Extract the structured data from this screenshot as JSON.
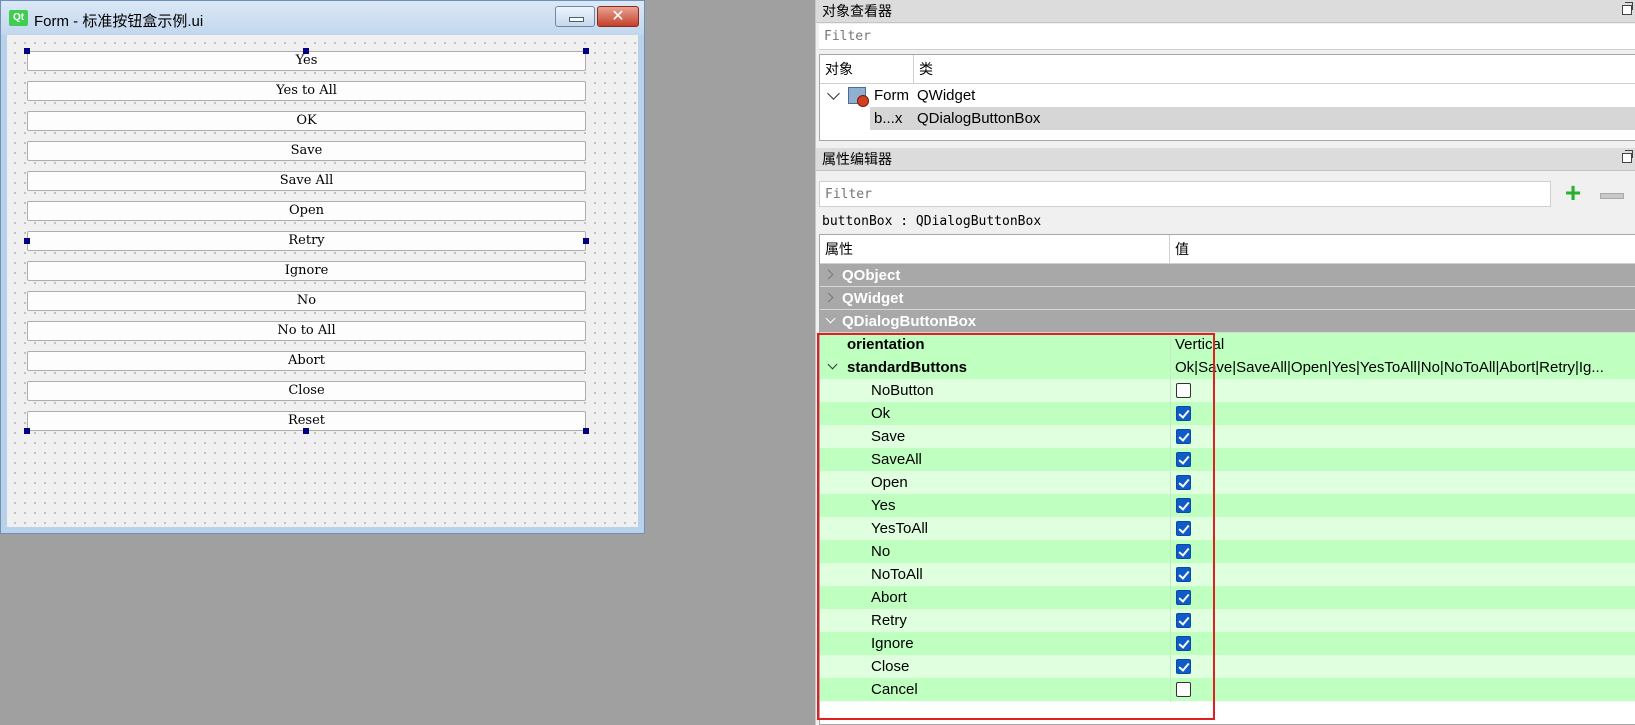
{
  "form_window": {
    "logo_text": "Qt",
    "title": "Form - 标准按钮盒示例.ui",
    "close_glyph": "✕",
    "buttons": [
      "Yes",
      "Yes to All",
      "OK",
      "Save",
      "Save All",
      "Open",
      "Retry",
      "Ignore",
      "No",
      "No to All",
      "Abort",
      "Close",
      "Reset"
    ]
  },
  "object_inspector": {
    "title": "对象查看器",
    "filter_placeholder": "Filter",
    "headers": {
      "object": "对象",
      "class": "类"
    },
    "rows": [
      {
        "name": "Form",
        "class": "QWidget"
      },
      {
        "name": "b...x",
        "class": "QDialogButtonBox"
      }
    ]
  },
  "property_editor": {
    "title": "属性编辑器",
    "filter_placeholder": "Filter",
    "add_glyph": "+",
    "object_line": "buttonBox : QDialogButtonBox",
    "headers": {
      "property": "属性",
      "value": "值"
    },
    "sections": [
      "QObject",
      "QWidget",
      "QDialogButtonBox"
    ],
    "orientation": {
      "name": "orientation",
      "value": "Vertical"
    },
    "standard_buttons": {
      "name": "standardButtons",
      "value": "Ok|Save|SaveAll|Open|Yes|YesToAll|No|NoToAll|Abort|Retry|Ig...",
      "flags": [
        {
          "name": "NoButton",
          "checked": false
        },
        {
          "name": "Ok",
          "checked": true
        },
        {
          "name": "Save",
          "checked": true
        },
        {
          "name": "SaveAll",
          "checked": true
        },
        {
          "name": "Open",
          "checked": true
        },
        {
          "name": "Yes",
          "checked": true
        },
        {
          "name": "YesToAll",
          "checked": true
        },
        {
          "name": "No",
          "checked": true
        },
        {
          "name": "NoToAll",
          "checked": true
        },
        {
          "name": "Abort",
          "checked": true
        },
        {
          "name": "Retry",
          "checked": true
        },
        {
          "name": "Ignore",
          "checked": true
        },
        {
          "name": "Close",
          "checked": true
        },
        {
          "name": "Cancel",
          "checked": false
        }
      ]
    }
  },
  "colors": {
    "highlight": "#e02020",
    "checkbox_checked": "#0f5cc8",
    "row_dark": "#bfffbf",
    "row_light": "#dfffdf",
    "section_bg": "#a8a8a8"
  }
}
